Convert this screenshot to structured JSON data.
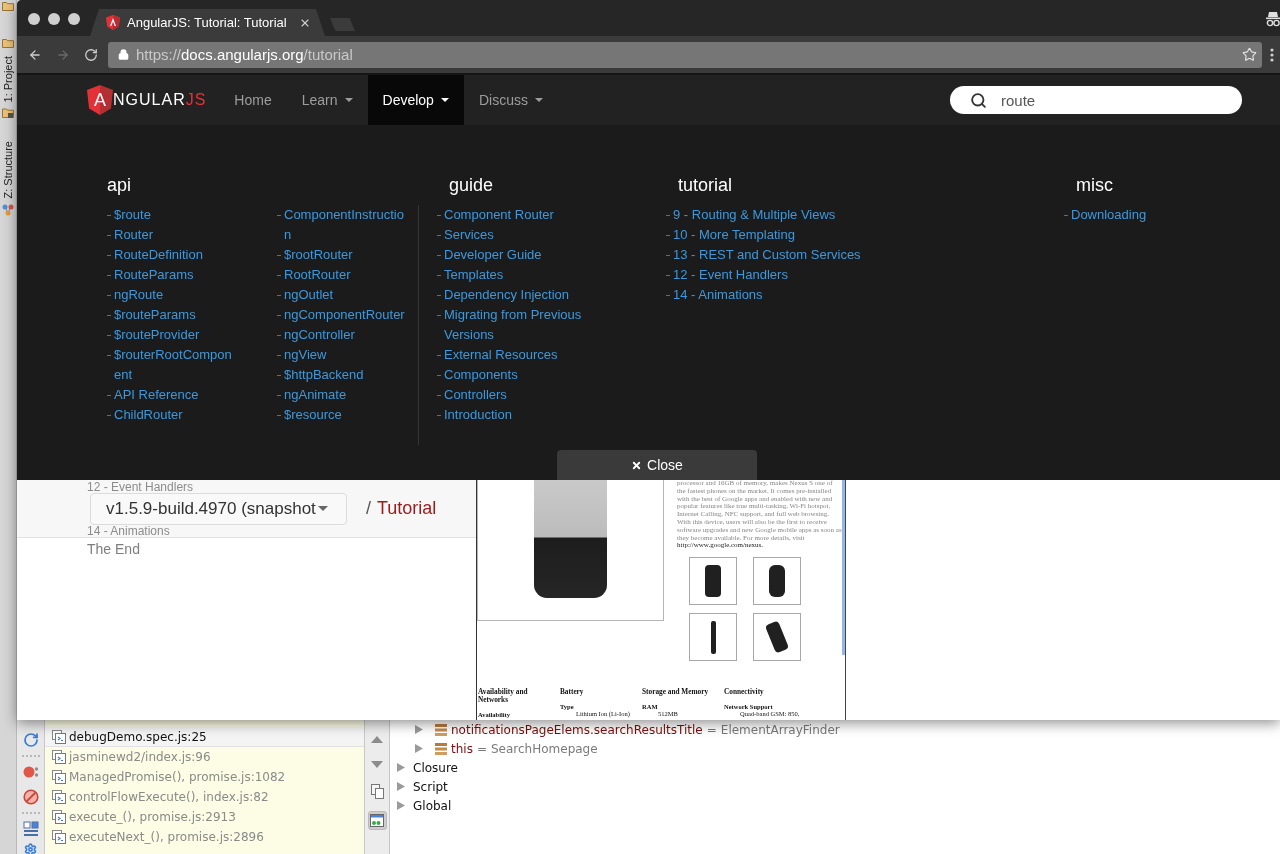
{
  "ide": {
    "side_tabs": [
      {
        "label": "1: Project"
      },
      {
        "label": "Z: Structure"
      }
    ]
  },
  "browser": {
    "tab": {
      "title": "AngularJS: Tutorial: Tutorial"
    },
    "nav_buttons": [
      {
        "kind": "back",
        "disabled": false
      },
      {
        "kind": "forward",
        "disabled": true
      },
      {
        "kind": "reload",
        "disabled": false
      }
    ],
    "url": {
      "scheme": "https://",
      "host": "docs.angularjs.org",
      "path": "/tutorial"
    }
  },
  "site": {
    "logo": {
      "initial": "A",
      "name": "NGULAR",
      "suffix": "JS"
    },
    "nav": [
      {
        "label": "Home",
        "dropdown": false,
        "selected": false
      },
      {
        "label": "Learn",
        "dropdown": true,
        "selected": false
      },
      {
        "label": "Develop",
        "dropdown": true,
        "selected": true
      },
      {
        "label": "Discuss",
        "dropdown": true,
        "selected": false
      }
    ],
    "search": {
      "value": "route"
    }
  },
  "menu": {
    "columns": [
      {
        "title": "api",
        "lists": [
          [
            "$route",
            "Router",
            "RouteDefinition",
            "RouteParams",
            "ngRoute",
            "$routeParams",
            "$routeProvider",
            "$routerRootComponent",
            "API Reference",
            "ChildRouter"
          ],
          [
            "ComponentInstruction",
            "$rootRouter",
            "RootRouter",
            "ngOutlet",
            "ngComponentRouter",
            "ngController",
            "ngView",
            "$httpBackend",
            "ngAnimate",
            "$resource"
          ]
        ]
      },
      {
        "title": "guide",
        "lists": [
          [
            "Component Router",
            "Services",
            "Developer Guide",
            "Templates",
            "Dependency Injection",
            "Migrating from Previous Versions",
            "External Resources",
            "Components",
            "Controllers",
            "Introduction"
          ]
        ]
      },
      {
        "title": "tutorial",
        "lists": [
          [
            "9 - Routing & Multiple Views",
            "10 - More Templating",
            "13 - REST and Custom Services",
            "12 - Event Handlers",
            "14 - Animations"
          ]
        ]
      },
      {
        "title": "misc",
        "lists": [
          [
            "Downloading"
          ]
        ]
      }
    ],
    "close_label": "Close"
  },
  "page": {
    "header_band": {
      "covered_links": [
        "12 - Event Handlers",
        "14 - Animations"
      ],
      "version_select": "v1.5.9-build.4970 (snapshot",
      "breadcrumb": {
        "separator": "/",
        "current": "Tutorial"
      }
    },
    "sidebar_links": [
      "The End"
    ],
    "document": {
      "description": "processor and 16GB of memory, makes Nexus S one of the fastest phones on the market. It comes pre-installed with the best of Google apps and enabled with new and popular features like true multi-tasking, Wi-Fi hotspot, Internet Calling, NFC support, and full web browsing. With this device, users will also be the first to receive software upgrades and new Google mobile apps as soon as they become available. For more details, visit",
      "link": "http://www.google.com/nexus.",
      "specs": [
        {
          "title": "Availability and Networks",
          "label": "Availability"
        },
        {
          "title": "Battery",
          "label": "Type",
          "value": "Lithium Ion (Li-Ion)"
        },
        {
          "title": "Storage and Memory",
          "label": "RAM",
          "value": "512MB"
        },
        {
          "title": "Connectivity",
          "label": "Network Support",
          "value": "Quad-band GSM: 850,"
        }
      ]
    }
  },
  "debugger": {
    "frames": [
      {
        "label": "debugDemo.spec.js:25",
        "library": false
      },
      {
        "label": "jasminewd2/index.js:96",
        "library": true
      },
      {
        "label": "ManagedPromise(), promise.js:1082",
        "library": true
      },
      {
        "label": "controlFlowExecute(), index.js:82",
        "library": true
      },
      {
        "label": "execute_(), promise.js:2913",
        "library": true
      },
      {
        "label": "executeNext_(), promise.js:2896",
        "library": true
      }
    ],
    "frame_toolbar": {
      "toggle_on": true
    },
    "variables": [
      {
        "kind": "field",
        "name": "notificationsPageElems.searchResultsTitle",
        "sign": "=",
        "value": "ElementArrayFinder",
        "expanded": false
      },
      {
        "kind": "field",
        "name": "this",
        "sign": "=",
        "value": "SearchHomepage",
        "expanded": false
      },
      {
        "kind": "scope",
        "name": "Closure",
        "expanded": false
      },
      {
        "kind": "scope",
        "name": "Script",
        "expanded": false
      },
      {
        "kind": "scope",
        "name": "Global",
        "expanded": false
      }
    ]
  }
}
